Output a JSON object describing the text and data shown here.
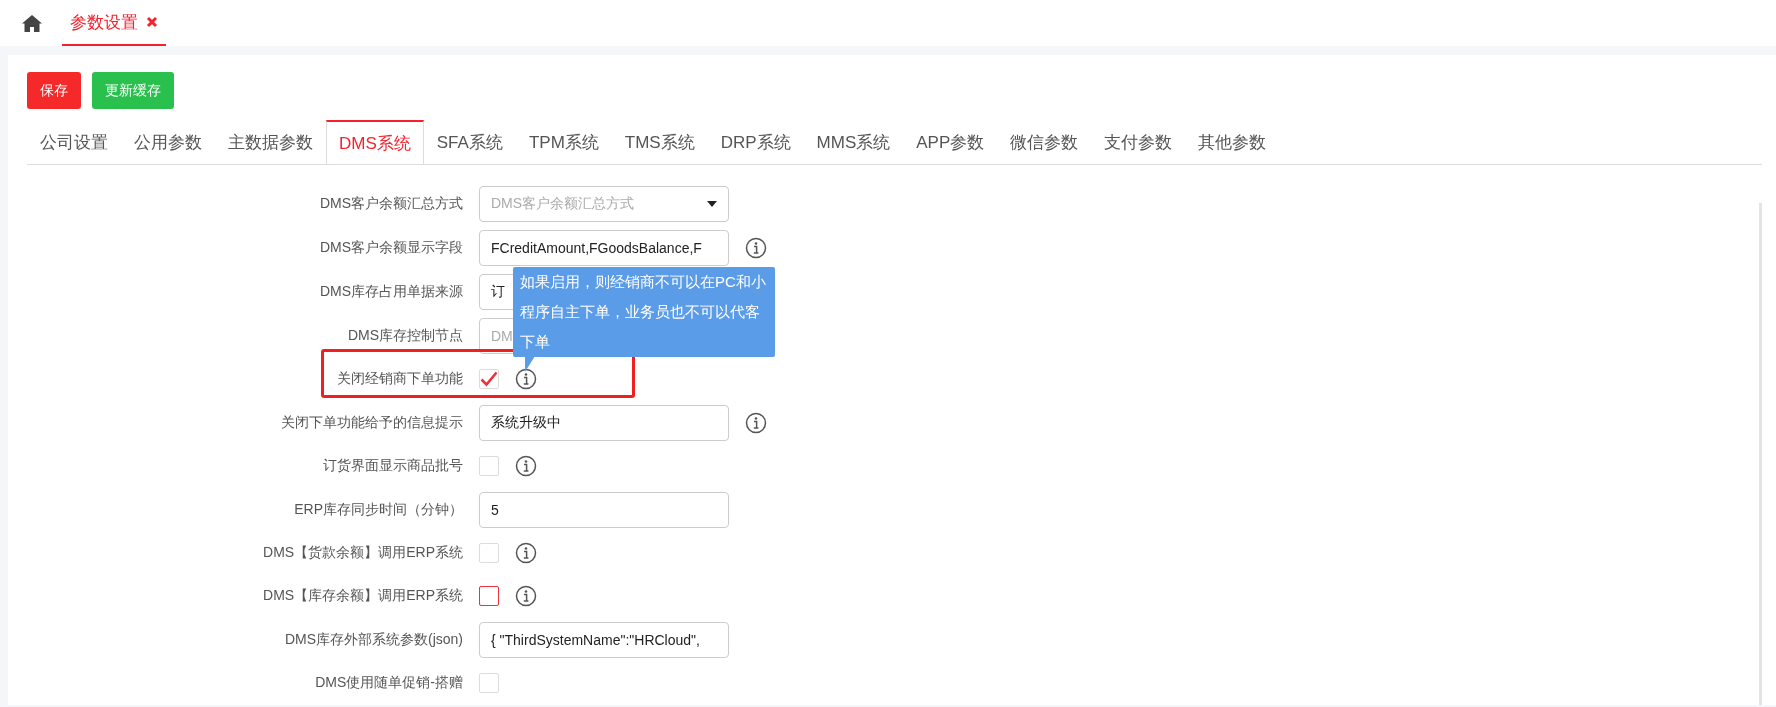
{
  "top_tabs": [
    {
      "label": "参数设置",
      "selected": true,
      "closable": true
    }
  ],
  "buttons": [
    {
      "label": "保存",
      "kind": "danger"
    },
    {
      "label": "更新缓存",
      "kind": "success"
    }
  ],
  "tabs": [
    {
      "label": "公司设置",
      "selected": false
    },
    {
      "label": "公用参数",
      "selected": false
    },
    {
      "label": "主数据参数",
      "selected": false
    },
    {
      "label": "DMS系统",
      "selected": true
    },
    {
      "label": "SFA系统",
      "selected": false
    },
    {
      "label": "TPM系统",
      "selected": false
    },
    {
      "label": "TMS系统",
      "selected": false
    },
    {
      "label": "DRP系统",
      "selected": false
    },
    {
      "label": "MMS系统",
      "selected": false
    },
    {
      "label": "APP参数",
      "selected": false
    },
    {
      "label": "微信参数",
      "selected": false
    },
    {
      "label": "支付参数",
      "selected": false
    },
    {
      "label": "其他参数",
      "selected": false
    }
  ],
  "settings": [
    {
      "kind": "select",
      "label": "DMS客户余额汇总方式",
      "placeholder": "DMS客户余额汇总方式",
      "info": false
    },
    {
      "kind": "text",
      "label": "DMS客户余额显示字段",
      "value": "FCreditAmount,FGoodsBalance,F",
      "info": true
    },
    {
      "kind": "text",
      "label": "DMS库存占用单据来源",
      "value": "订",
      "info": false
    },
    {
      "kind": "text",
      "label": "DMS库存控制节点",
      "placeholder": "DM",
      "info": false
    },
    {
      "kind": "checkbox",
      "label": "关闭经销商下单功能",
      "checked": true,
      "focused": false,
      "info": true,
      "highlighted": true,
      "tooltip": "如果启用，则经销商不可以在PC和小程序自主下单，业务员也不可以代客下单"
    },
    {
      "kind": "text",
      "label": "关闭下单功能给予的信息提示",
      "value": "系统升级中",
      "info": true
    },
    {
      "kind": "checkbox",
      "label": "订货界面显示商品批号",
      "checked": false,
      "focused": false,
      "info": true
    },
    {
      "kind": "text",
      "label": "ERP库存同步时间（分钟）",
      "value": "5",
      "info": false
    },
    {
      "kind": "checkbox",
      "label": "DMS【货款余额】调用ERP系统",
      "checked": false,
      "focused": false,
      "info": true
    },
    {
      "kind": "checkbox",
      "label": "DMS【库存余额】调用ERP系统",
      "checked": false,
      "focused": true,
      "info": true
    },
    {
      "kind": "text",
      "label": "DMS库存外部系统参数(json)",
      "value": "{ \"ThirdSystemName\":\"HRCloud\",",
      "info": false
    },
    {
      "kind": "checkbox",
      "label": "DMS使用随单促销-搭赠",
      "checked": false,
      "focused": false,
      "info": false
    }
  ]
}
